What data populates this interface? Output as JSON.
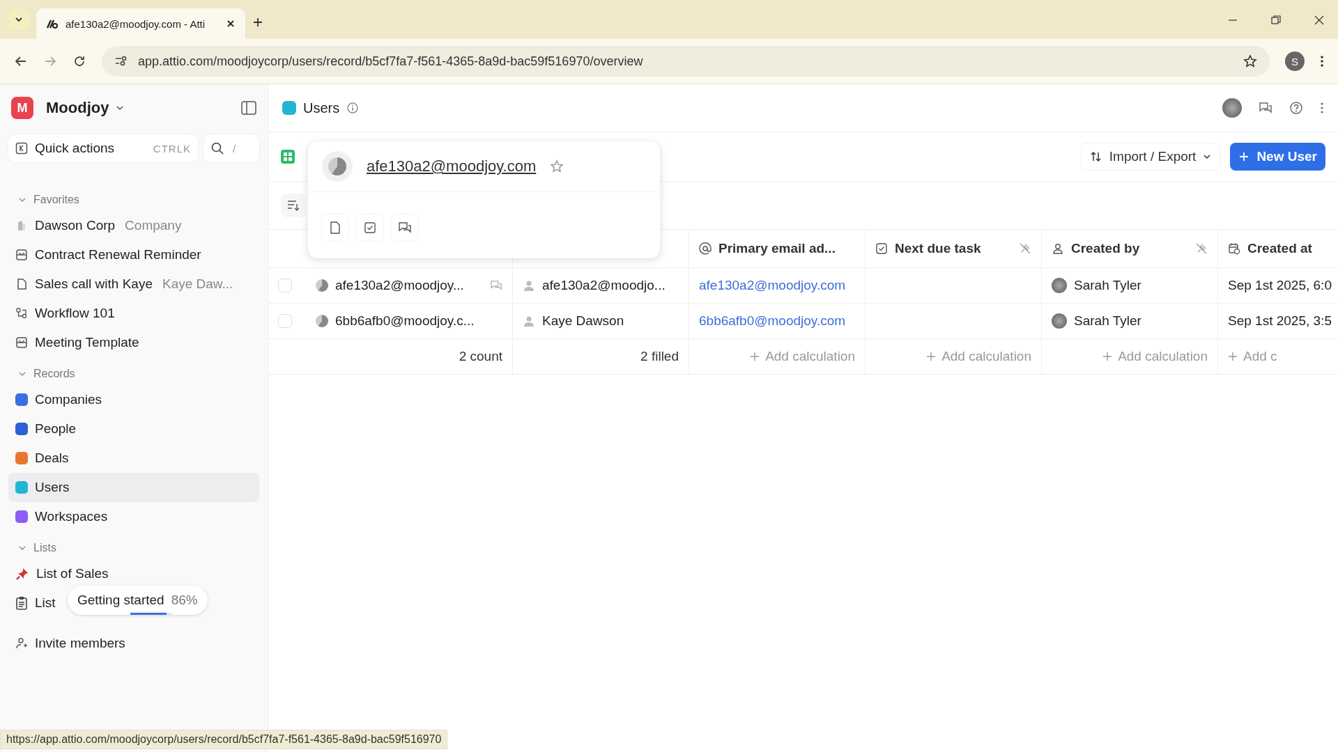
{
  "browser": {
    "tab_title": "afe130a2@moodjoy.com - Atti",
    "url": "app.attio.com/moodjoycorp/users/record/b5cf7fa7-f561-4365-8a9d-bac59f516970/overview",
    "profile": "S",
    "status_url": "https://app.attio.com/moodjoycorp/users/record/b5cf7fa7-f561-4365-8a9d-bac59f516970"
  },
  "sidebar": {
    "workspace": "Moodjoy",
    "workspace_initial": "M",
    "quick_actions": "Quick actions",
    "shortcut": "CTRLK",
    "search_shortcut": "/",
    "sections": [
      {
        "title": "Favorites",
        "items": [
          {
            "label": "Dawson Corp",
            "sub": "Company",
            "kind": "company",
            "selected": false
          },
          {
            "label": "Contract Renewal Reminder",
            "kind": "template",
            "selected": false
          },
          {
            "label": "Sales call with Kaye",
            "sub": "Kaye Daw...",
            "kind": "note",
            "selected": false
          },
          {
            "label": "Workflow 101",
            "kind": "workflow",
            "selected": false
          },
          {
            "label": "Meeting Template",
            "kind": "template",
            "selected": false
          }
        ]
      },
      {
        "title": "Records",
        "items": [
          {
            "label": "Companies",
            "kind": "object",
            "color": "#3b6fe0",
            "selected": false
          },
          {
            "label": "People",
            "kind": "object",
            "color": "#2f5fd6",
            "selected": false
          },
          {
            "label": "Deals",
            "kind": "object",
            "color": "#e8772e",
            "selected": false
          },
          {
            "label": "Users",
            "kind": "object",
            "color": "#23b5d3",
            "selected": true
          },
          {
            "label": "Workspaces",
            "kind": "object",
            "color": "#8b5cf6",
            "selected": false
          }
        ]
      },
      {
        "title": "Lists",
        "items": [
          {
            "label": "List of Sales",
            "kind": "pin",
            "selected": false
          },
          {
            "label": "List",
            "kind": "clipboard",
            "selected": false
          }
        ]
      }
    ],
    "getting_started": {
      "label": "Getting started",
      "percent": "86%",
      "level": 0.86
    },
    "invite": "Invite members"
  },
  "header": {
    "title": "Users",
    "import_export": "Import / Export",
    "new_button": "New User"
  },
  "popover": {
    "title": "afe130a2@moodjoy.com"
  },
  "table": {
    "columns": [
      {
        "label": "Primary email ad...",
        "kind": "email"
      },
      {
        "label": "Next due task",
        "kind": "task"
      },
      {
        "label": "Created by",
        "kind": "person"
      },
      {
        "label": "Created at",
        "kind": "date"
      }
    ],
    "rows": [
      {
        "name": "afe130a2@moodjoy...",
        "user": "afe130a2@moodjo...",
        "email": "afe130a2@moodjoy.com",
        "created_by": "Sarah Tyler",
        "created_at": "Sep 1st 2025, 6:0",
        "checked": false
      },
      {
        "name": "6bb6afb0@moodjoy.c...",
        "user": "Kaye Dawson",
        "email": "6bb6afb0@moodjoy.com",
        "created_by": "Sarah Tyler",
        "created_at": "Sep 1st 2025, 3:5",
        "checked": false
      }
    ],
    "footer": [
      "2 count",
      "2 filled",
      "Add calculation",
      "Add calculation",
      "Add calculation",
      "Add c"
    ]
  }
}
